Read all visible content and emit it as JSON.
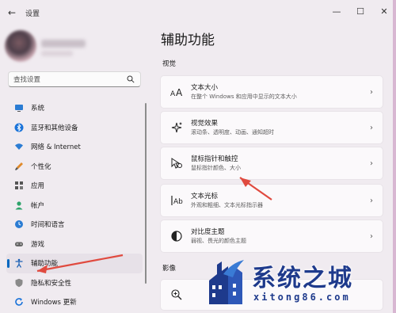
{
  "window": {
    "title": "设置",
    "back_glyph": "←",
    "min_glyph": "—",
    "max_glyph": "☐",
    "close_glyph": "✕"
  },
  "search": {
    "placeholder": "查找设置"
  },
  "sidebar": {
    "items": [
      {
        "label": "系统",
        "icon": "monitor-icon"
      },
      {
        "label": "蓝牙和其他设备",
        "icon": "bluetooth-icon"
      },
      {
        "label": "网络 & Internet",
        "icon": "wifi-icon"
      },
      {
        "label": "个性化",
        "icon": "brush-icon"
      },
      {
        "label": "应用",
        "icon": "apps-icon"
      },
      {
        "label": "帐户",
        "icon": "account-icon"
      },
      {
        "label": "时间和语言",
        "icon": "globe-clock-icon"
      },
      {
        "label": "游戏",
        "icon": "gamepad-icon"
      },
      {
        "label": "辅助功能",
        "icon": "accessibility-icon",
        "active": true
      },
      {
        "label": "隐私和安全性",
        "icon": "shield-icon"
      },
      {
        "label": "Windows 更新",
        "icon": "update-icon"
      }
    ]
  },
  "main": {
    "title": "辅助功能",
    "section_vision": "视觉",
    "section_hearing": "影像",
    "cards": [
      {
        "title": "文本大小",
        "subtitle": "在整个 Windows 和应用中显示的文本大小",
        "icon": "text-size-icon"
      },
      {
        "title": "视觉效果",
        "subtitle": "滚动条、透明度、动画、通知超时",
        "icon": "visual-effects-icon"
      },
      {
        "title": "鼠标指针和触控",
        "subtitle": "鼠标指针颜色、大小",
        "icon": "mouse-pointer-icon"
      },
      {
        "title": "文本光标",
        "subtitle": "外观和粗细、文本光标指示器",
        "icon": "text-cursor-icon"
      },
      {
        "title": "对比度主题",
        "subtitle": "弱视、畏光的颜色主题",
        "icon": "contrast-icon"
      }
    ],
    "chevron": "›"
  },
  "watermark": {
    "title": "系统之城",
    "url": "xitong86.com"
  },
  "colors": {
    "accent": "#0067c0",
    "arrow": "#e04a3f",
    "watermark": "#1e3a8c"
  }
}
